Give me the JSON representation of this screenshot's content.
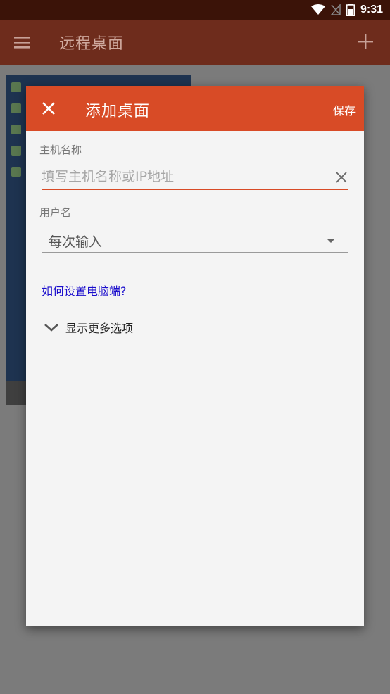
{
  "status_bar": {
    "time": "9:31"
  },
  "app_bar": {
    "title": "远程桌面"
  },
  "dialog": {
    "title": "添加桌面",
    "save_label": "保存",
    "host": {
      "label": "主机名称",
      "placeholder": "填写主机名称或IP地址",
      "value": ""
    },
    "username": {
      "label": "用户名",
      "selected": "每次输入"
    },
    "help_link": "如何设置电脑端?",
    "more_options": "显示更多选项"
  },
  "colors": {
    "accent": "#d84b26",
    "app_bar": "#6e2c1c",
    "status_bar": "#3b1308",
    "link": "#1a0dcc"
  }
}
